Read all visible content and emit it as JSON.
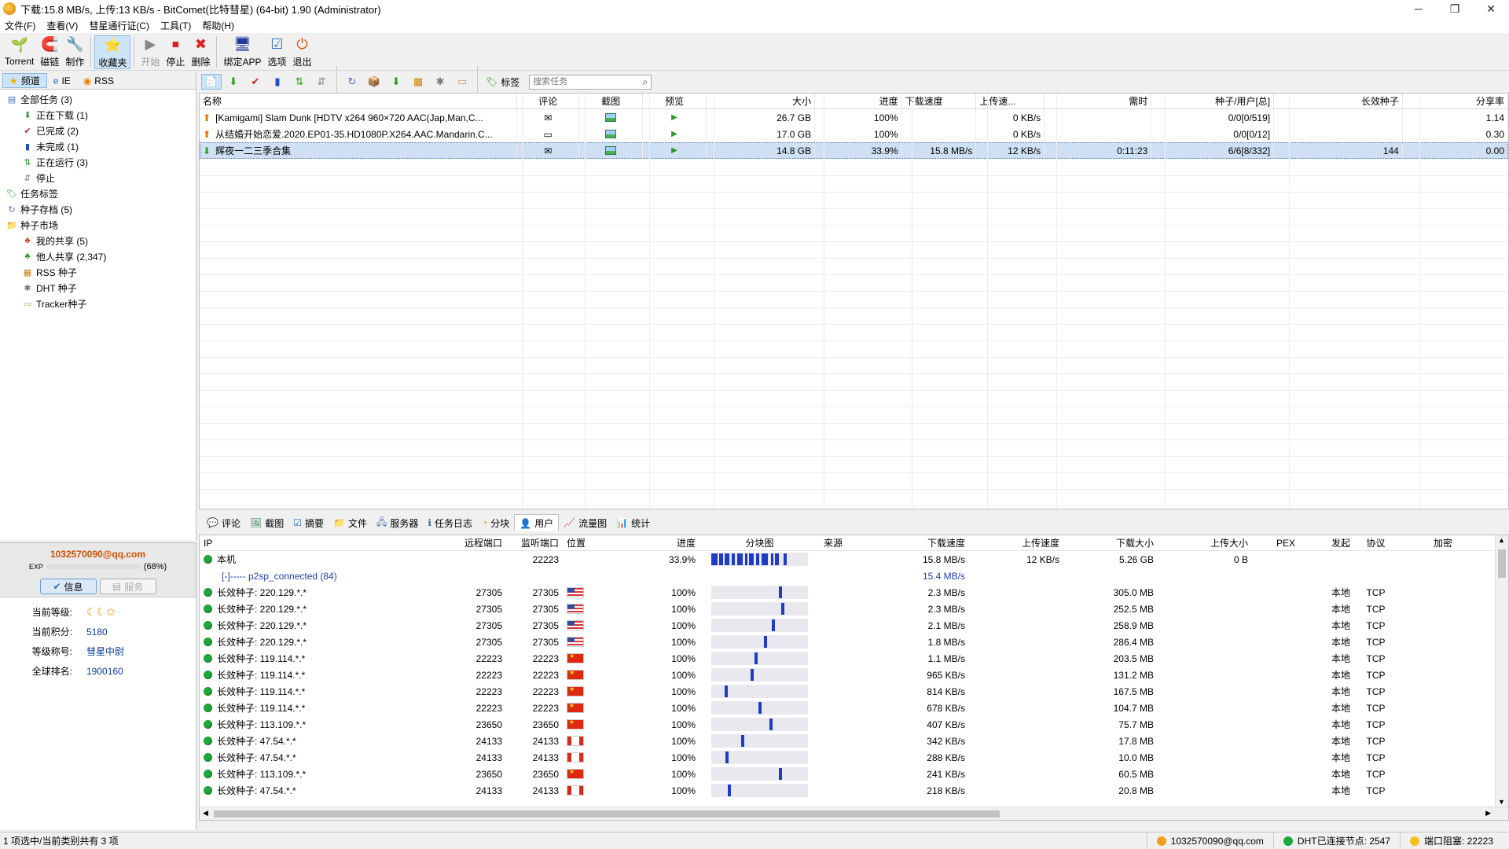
{
  "window": {
    "title": "下载:15.8 MB/s, 上传:13 KB/s - BitComet(比特彗星) (64-bit) 1.90 (Administrator)",
    "minimize": "─",
    "restore": "❐",
    "close": "✕"
  },
  "menu": [
    "文件(F)",
    "查看(V)",
    "彗星通行证(C)",
    "工具(T)",
    "帮助(H)"
  ],
  "toolbar": [
    {
      "label": "Torrent",
      "icon": "torrent-icon",
      "glyph": "🌱",
      "state": "normal"
    },
    {
      "label": "磁链",
      "icon": "magnet-icon",
      "glyph": "🧲",
      "state": "normal"
    },
    {
      "label": "制作",
      "icon": "make-torrent-icon",
      "glyph": "🔧",
      "state": "normal"
    },
    {
      "label": "收藏夹",
      "icon": "favorites-star-icon",
      "glyph": "⭐",
      "state": "active"
    },
    {
      "label": "开始",
      "icon": "start-icon",
      "glyph": "▶",
      "state": "disabled"
    },
    {
      "label": "停止",
      "icon": "stop-icon",
      "glyph": "⏹",
      "state": "normal"
    },
    {
      "label": "删除",
      "icon": "delete-icon",
      "glyph": "✖",
      "state": "normal"
    },
    {
      "label": "绑定APP",
      "icon": "bind-app-icon",
      "glyph": "🖥",
      "state": "normal"
    },
    {
      "label": "选项",
      "icon": "options-icon",
      "glyph": "☑",
      "state": "normal"
    },
    {
      "label": "退出",
      "icon": "exit-icon",
      "glyph": "⏻",
      "state": "normal"
    }
  ],
  "left_tabs": [
    {
      "label": "频道",
      "icon": "channel-star-icon",
      "glyph": "★",
      "active": true
    },
    {
      "label": "IE",
      "icon": "ie-icon",
      "glyph": "e",
      "active": false
    },
    {
      "label": "RSS",
      "icon": "rss-icon",
      "glyph": "◉",
      "active": false
    }
  ],
  "tree": [
    {
      "label": "全部任务 (3)",
      "icon": "all-tasks-icon",
      "glyph": "▤",
      "indent": 0
    },
    {
      "label": "正在下载 (1)",
      "icon": "downloading-icon",
      "glyph": "⬇",
      "indent": 1
    },
    {
      "label": "已完成 (2)",
      "icon": "completed-check-icon",
      "glyph": "✔",
      "indent": 1
    },
    {
      "label": "未完成 (1)",
      "icon": "incomplete-icon",
      "glyph": "▮",
      "indent": 1
    },
    {
      "label": "正在运行 (3)",
      "icon": "running-icon",
      "glyph": "⇅",
      "indent": 1
    },
    {
      "label": "停止",
      "icon": "stopped-icon",
      "glyph": "⇵",
      "indent": 1
    },
    {
      "label": "任务标签",
      "icon": "task-tag-icon",
      "glyph": "🏷",
      "indent": 0
    },
    {
      "label": "种子存档 (5)",
      "icon": "torrent-archive-icon",
      "glyph": "↻",
      "indent": 0
    },
    {
      "label": "种子市场",
      "icon": "torrent-market-icon",
      "glyph": "📁",
      "indent": 0
    },
    {
      "label": "我的共享 (5)",
      "icon": "my-share-icon",
      "glyph": "♣",
      "indent": 1
    },
    {
      "label": "他人共享 (2,347)",
      "icon": "others-share-icon",
      "glyph": "♣",
      "indent": 1
    },
    {
      "label": "RSS 种子",
      "icon": "rss-seed-icon",
      "glyph": "▦",
      "indent": 1
    },
    {
      "label": "DHT 种子",
      "icon": "dht-seed-icon",
      "glyph": "✱",
      "indent": 1
    },
    {
      "label": "Tracker种子",
      "icon": "tracker-seed-icon",
      "glyph": "▭",
      "indent": 1
    }
  ],
  "userinfo": {
    "email": "1032570090@qq.com",
    "exp_label": "EXP",
    "exp_percent": "(68%)",
    "exp_fraction": 0.68,
    "tab_info": "信息",
    "tab_service": "服务",
    "rows": [
      {
        "label": "当前等级:",
        "value": "☾☾✩"
      },
      {
        "label": "当前积分:",
        "value": "5180"
      },
      {
        "label": "等级称号:",
        "value": "彗星中尉"
      },
      {
        "label": "全球排名:",
        "value": "1900160"
      }
    ]
  },
  "task_toolbar": {
    "icons": [
      "📄",
      "⬇",
      "✔",
      "▮",
      "⇅",
      "⇵",
      "↻",
      "📦",
      "⬇",
      "▦",
      "✱",
      "▭"
    ],
    "tag_label": "标签",
    "search_placeholder": "搜索任务"
  },
  "task_columns": [
    "名称",
    "评论",
    "截图",
    "预览",
    "大小",
    "进度",
    "下载速度",
    "上传速...",
    "需时",
    "种子/用户[总]",
    "长效种子",
    "分享率"
  ],
  "tasks": [
    {
      "name": "[Kamigami] Slam Dunk [HDTV x264 960×720 AAC(Jap,Man,C...",
      "status": "upload",
      "comment": "✉",
      "size": "26.7 GB",
      "progress": "100%",
      "down": "",
      "up": "0 KB/s",
      "eta": "",
      "seeds": "0/0[0/519]",
      "longseed": "",
      "ratio": "1.14",
      "selected": false
    },
    {
      "name": "从结婚开始恋爱.2020.EP01-35.HD1080P.X264.AAC.Mandarin.C...",
      "status": "upload",
      "comment": "▭",
      "size": "17.0 GB",
      "progress": "100%",
      "down": "",
      "up": "0 KB/s",
      "eta": "",
      "seeds": "0/0[0/12]",
      "longseed": "",
      "ratio": "0.30",
      "selected": false
    },
    {
      "name": "辉夜一二三季合集",
      "status": "download",
      "comment": "✉",
      "size": "14.8 GB",
      "progress": "33.9%",
      "down": "15.8 MB/s",
      "up": "12 KB/s",
      "eta": "0:11:23",
      "seeds": "6/6[8/332]",
      "longseed": "144",
      "ratio": "0.00",
      "selected": true
    }
  ],
  "bottom_tabs": [
    {
      "label": "评论",
      "glyph": "💬",
      "icon": "comment-icon"
    },
    {
      "label": "截图",
      "glyph": "🖼",
      "icon": "screenshot-icon"
    },
    {
      "label": "摘要",
      "glyph": "☑",
      "icon": "summary-icon"
    },
    {
      "label": "文件",
      "glyph": "📁",
      "icon": "files-icon"
    },
    {
      "label": "服务器",
      "glyph": "🖧",
      "icon": "server-icon"
    },
    {
      "label": "任务日志",
      "glyph": "ℹ",
      "icon": "task-log-icon"
    },
    {
      "label": "分块",
      "glyph": "◔",
      "icon": "pieces-icon"
    },
    {
      "label": "用户",
      "glyph": "👤",
      "icon": "peers-icon",
      "active": true
    },
    {
      "label": "流量图",
      "glyph": "📈",
      "icon": "traffic-graph-icon"
    },
    {
      "label": "统计",
      "glyph": "📊",
      "icon": "statistics-icon"
    }
  ],
  "peer_columns": [
    "IP",
    "远程端口",
    "监听端口",
    "位置",
    "进度",
    "分块图",
    "来源",
    "下载速度",
    "上传速度",
    "下载大小",
    "上传大小",
    "PEX",
    "发起",
    "协议",
    "加密"
  ],
  "peer_local": {
    "ip": "本机",
    "listen_port": "22223",
    "progress": "33.9%",
    "down": "15.8 MB/s",
    "up": "12 KB/s",
    "down_size": "5.26 GB",
    "up_size": "0 B"
  },
  "peer_group": {
    "label": "[-]----- p2sp_connected (84)",
    "down": "15.4 MB/s"
  },
  "peers": [
    {
      "ip": "长效种子: 220.129.*.*",
      "rport": "27305",
      "lport": "27305",
      "flag": "us",
      "progress": "100%",
      "piece": 0.72,
      "down": "2.3 MB/s",
      "size": "305.0 MB",
      "init": "本地",
      "proto": "TCP"
    },
    {
      "ip": "长效种子: 220.129.*.*",
      "rport": "27305",
      "lport": "27305",
      "flag": "us",
      "progress": "100%",
      "piece": 0.75,
      "down": "2.3 MB/s",
      "size": "252.5 MB",
      "init": "本地",
      "proto": "TCP"
    },
    {
      "ip": "长效种子: 220.129.*.*",
      "rport": "27305",
      "lport": "27305",
      "flag": "us",
      "progress": "100%",
      "piece": 0.65,
      "down": "2.1 MB/s",
      "size": "258.9 MB",
      "init": "本地",
      "proto": "TCP"
    },
    {
      "ip": "长效种子: 220.129.*.*",
      "rport": "27305",
      "lport": "27305",
      "flag": "us",
      "progress": "100%",
      "piece": 0.56,
      "down": "1.8 MB/s",
      "size": "286.4 MB",
      "init": "本地",
      "proto": "TCP"
    },
    {
      "ip": "长效种子: 119.114.*.*",
      "rport": "22223",
      "lport": "22223",
      "flag": "cn",
      "progress": "100%",
      "piece": 0.46,
      "down": "1.1 MB/s",
      "size": "203.5 MB",
      "init": "本地",
      "proto": "TCP"
    },
    {
      "ip": "长效种子: 119.114.*.*",
      "rport": "22223",
      "lport": "22223",
      "flag": "cn",
      "progress": "100%",
      "piece": 0.42,
      "down": "965 KB/s",
      "size": "131.2 MB",
      "init": "本地",
      "proto": "TCP"
    },
    {
      "ip": "长效种子: 119.114.*.*",
      "rport": "22223",
      "lport": "22223",
      "flag": "cn",
      "progress": "100%",
      "piece": 0.14,
      "down": "814 KB/s",
      "size": "167.5 MB",
      "init": "本地",
      "proto": "TCP"
    },
    {
      "ip": "长效种子: 119.114.*.*",
      "rport": "22223",
      "lport": "22223",
      "flag": "cn",
      "progress": "100%",
      "piece": 0.5,
      "down": "678 KB/s",
      "size": "104.7 MB",
      "init": "本地",
      "proto": "TCP"
    },
    {
      "ip": "长效种子: 113.109.*.*",
      "rport": "23650",
      "lport": "23650",
      "flag": "cn",
      "progress": "100%",
      "piece": 0.62,
      "down": "407 KB/s",
      "size": "75.7 MB",
      "init": "本地",
      "proto": "TCP"
    },
    {
      "ip": "长效种子: 47.54.*.*",
      "rport": "24133",
      "lport": "24133",
      "flag": "ca",
      "progress": "100%",
      "piece": 0.32,
      "down": "342 KB/s",
      "size": "17.8 MB",
      "init": "本地",
      "proto": "TCP"
    },
    {
      "ip": "长效种子: 47.54.*.*",
      "rport": "24133",
      "lport": "24133",
      "flag": "ca",
      "progress": "100%",
      "piece": 0.15,
      "down": "288 KB/s",
      "size": "10.0 MB",
      "init": "本地",
      "proto": "TCP"
    },
    {
      "ip": "长效种子: 113.109.*.*",
      "rport": "23650",
      "lport": "23650",
      "flag": "cn",
      "progress": "100%",
      "piece": 0.72,
      "down": "241 KB/s",
      "size": "60.5 MB",
      "init": "本地",
      "proto": "TCP"
    },
    {
      "ip": "长效种子: 47.54.*.*",
      "rport": "24133",
      "lport": "24133",
      "flag": "ca",
      "progress": "100%",
      "piece": 0.18,
      "down": "218 KB/s",
      "size": "20.8 MB",
      "init": "本地",
      "proto": "TCP"
    }
  ],
  "statusbar": {
    "left": "1 项选中/当前类别共有 3 项",
    "account": "1032570090@qq.com",
    "dht": "DHT已连接节点:  2547",
    "port": "端口阻塞:  22223"
  }
}
